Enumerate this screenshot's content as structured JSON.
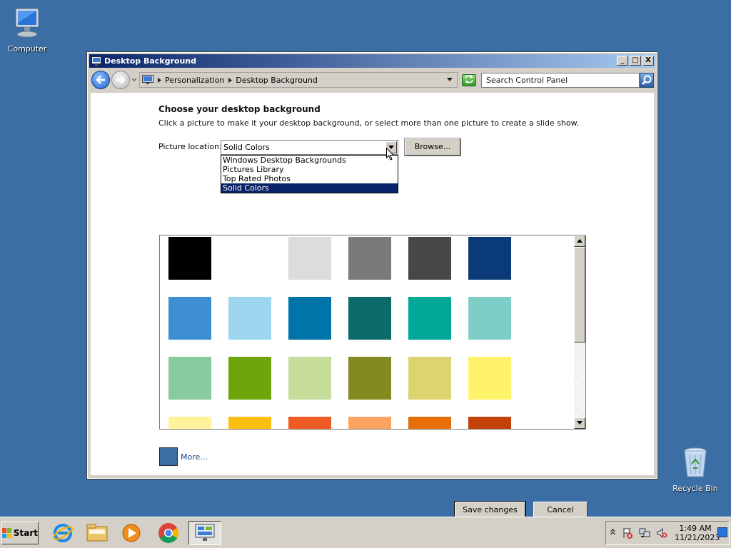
{
  "desktop": {
    "icons": [
      {
        "label": "Computer"
      },
      {
        "label": "Recycle Bin"
      }
    ]
  },
  "window": {
    "title": "Desktop Background",
    "controls": {
      "minimize": "_",
      "maximize": "□",
      "close": "X"
    }
  },
  "navbar": {
    "breadcrumb": [
      "Personalization",
      "Desktop Background"
    ],
    "search_placeholder": "Search Control Panel"
  },
  "content": {
    "heading": "Choose your desktop background",
    "instructions": "Click a picture to make it your desktop background, or select more than one picture to create a slide show.",
    "location_label": "Picture location:",
    "location_value": "Solid Colors",
    "browse_label": "Browse...",
    "location_options": [
      {
        "label": "Windows Desktop Backgrounds",
        "selected": false
      },
      {
        "label": "Pictures Library",
        "selected": false
      },
      {
        "label": "Top Rated Photos",
        "selected": false
      },
      {
        "label": "Solid Colors",
        "selected": true
      }
    ],
    "swatch_rows": [
      [
        "#000000",
        "#ffffff",
        "#dcdcdc",
        "#7a7a7a",
        "#474747",
        "#0a3b78"
      ],
      [
        "#3d8fd1",
        "#9dd6ee",
        "#0073a8",
        "#0b6b6b",
        "#00a89a",
        "#7ecdc6"
      ],
      [
        "#88cb9f",
        "#6ea50c",
        "#c6dd9c",
        "#848a1f",
        "#dcd56f",
        "#fff36b"
      ],
      [
        "#fff29a",
        "#fbbf12",
        "#ee5c23",
        "#fba360",
        "#e76f09",
        "#c3420a"
      ]
    ],
    "more_color": "#3a6ea5",
    "more_label": "More...",
    "save_label": "Save changes",
    "cancel_label": "Cancel"
  },
  "taskbar": {
    "start_label": "Start",
    "apps": [
      {
        "name": "internet-explorer-icon"
      },
      {
        "name": "file-explorer-icon"
      },
      {
        "name": "media-player-icon"
      },
      {
        "name": "chrome-icon"
      },
      {
        "name": "control-panel-icon",
        "active": true
      }
    ],
    "time": "1:49 AM",
    "date": "11/21/2023"
  }
}
